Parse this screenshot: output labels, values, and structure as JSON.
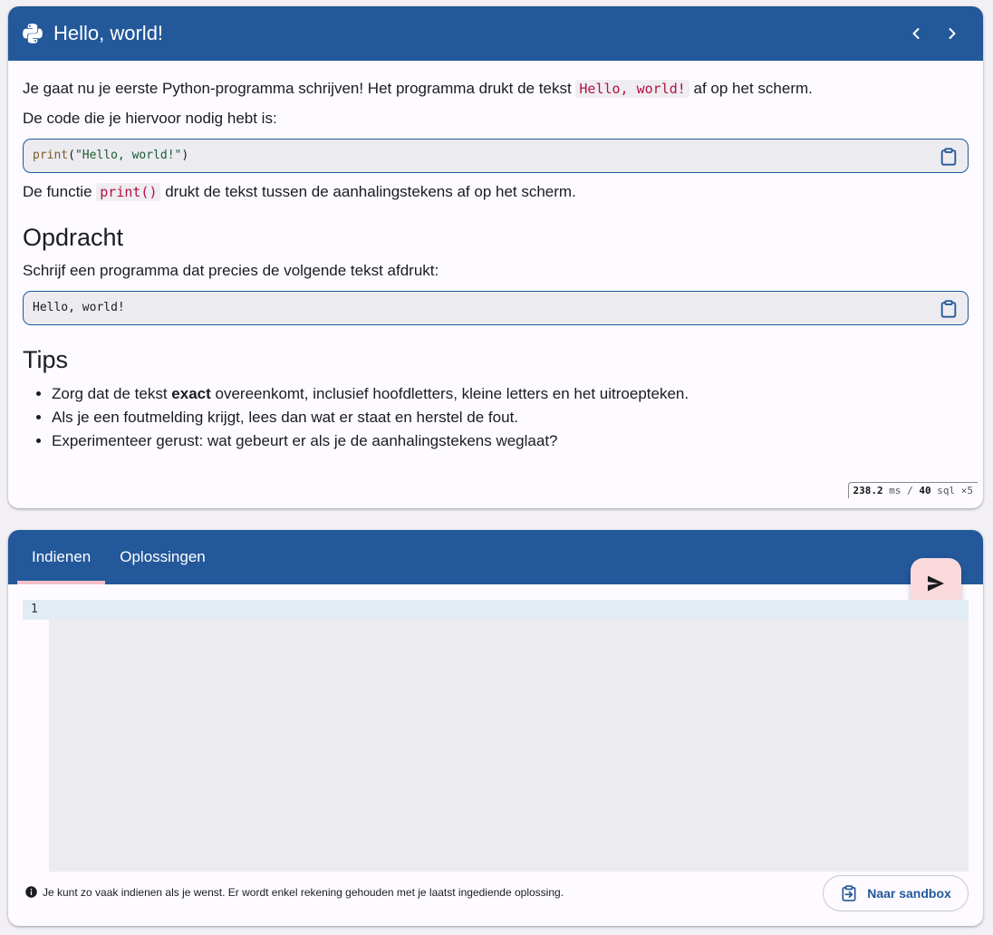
{
  "exercise": {
    "title": "Hello, world!",
    "intro_before": "Je gaat nu je eerste Python-programma schrijven! Het programma drukt de tekst ",
    "intro_code": "Hello, world!",
    "intro_after": " af op het scherm.",
    "code_intro": "De code die je hiervoor nodig hebt is:",
    "code_fn": "print",
    "code_open": "(",
    "code_str": "\"Hello, world!\"",
    "code_close": ")",
    "explain_before": "De functie ",
    "explain_code": "print()",
    "explain_after": " drukt de tekst tussen de aanhalingstekens af op het scherm.",
    "assignment_heading": "Opdracht",
    "assignment_text": "Schrijf een programma dat precies de volgende tekst afdrukt:",
    "expected_output": "Hello, world!",
    "tips_heading": "Tips",
    "tip1_before": "Zorg dat de tekst ",
    "tip1_bold": "exact",
    "tip1_after": " overeenkomt, inclusief hoofdletters, kleine letters en het uitroepteken.",
    "tip2": "Als je een foutmelding krijgt, lees dan wat er staat en herstel de fout.",
    "tip3": "Experimenteer gerust: wat gebeurt er als je de aanhalingstekens weglaat?",
    "perf_ms_value": "238.2",
    "perf_ms_unit": "ms",
    "perf_sep": "/",
    "perf_sql_count": "40",
    "perf_sql_unit": "sql",
    "perf_multiplier": "×5"
  },
  "submit": {
    "tabs": [
      "Indienen",
      "Oplossingen"
    ],
    "line_number": "1",
    "info_text": "Je kunt zo vaak indienen als je wenst. Er wordt enkel rekening gehouden met je laatst ingediende oplossing.",
    "sandbox_label": "Naar sandbox"
  },
  "colors": {
    "primary": "#23589a",
    "inline_code": "#b3113e",
    "tab_indicator": "#f6c1c8",
    "fab_bg": "#fadadd"
  },
  "icons": [
    "python-icon",
    "chevron-left-icon",
    "chevron-right-icon",
    "clipboard-icon",
    "send-icon",
    "info-icon",
    "clipboard-arrow-icon"
  ]
}
